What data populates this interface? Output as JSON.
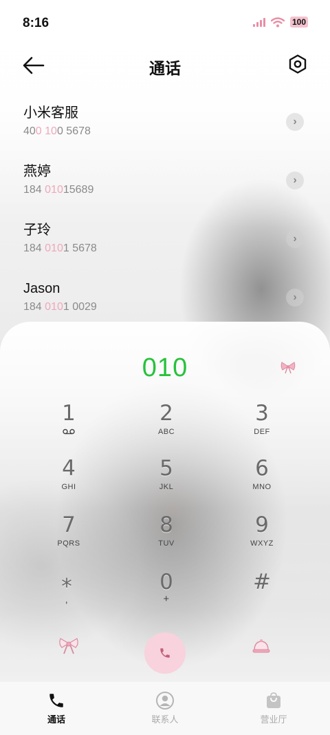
{
  "status_bar": {
    "time": "8:16",
    "battery": "100",
    "signal_color": "#e88ea5"
  },
  "header": {
    "title": "通话",
    "back_icon": "back-arrow-icon",
    "settings_icon": "settings-icon"
  },
  "contacts": [
    {
      "name": "小米客服",
      "num_a": "40",
      "num_b": "0",
      "num_c": " ",
      "num_d": "10",
      "num_e": "0 5678"
    },
    {
      "name": "燕婷",
      "num_a": "184 ",
      "num_b": "",
      "num_c": "",
      "num_d": "010",
      "num_e": "15689"
    },
    {
      "name": "子玲",
      "num_a": "184 ",
      "num_b": "",
      "num_c": "",
      "num_d": "010",
      "num_e": "1 5678"
    },
    {
      "name": "Jason",
      "num_a": "184 ",
      "num_b": "",
      "num_c": "",
      "num_d": "010",
      "num_e": "1 0029"
    }
  ],
  "dialed_number": "010",
  "keypad": [
    {
      "digit": "1",
      "letters": "ꝏ"
    },
    {
      "digit": "2",
      "letters": "ABC"
    },
    {
      "digit": "3",
      "letters": "DEF"
    },
    {
      "digit": "4",
      "letters": "GHI"
    },
    {
      "digit": "5",
      "letters": "JKL"
    },
    {
      "digit": "6",
      "letters": "MNO"
    },
    {
      "digit": "7",
      "letters": "PQRS"
    },
    {
      "digit": "8",
      "letters": "TUV"
    },
    {
      "digit": "9",
      "letters": "WXYZ"
    },
    {
      "digit": "*",
      "letters": ","
    },
    {
      "digit": "0",
      "letters": "+"
    },
    {
      "digit": "#",
      "letters": ""
    }
  ],
  "tabs": [
    {
      "label": "通话",
      "icon": "phone-icon",
      "active": true
    },
    {
      "label": "联系人",
      "icon": "person-icon",
      "active": false
    },
    {
      "label": "营业厅",
      "icon": "shopping-bag-icon",
      "active": false
    }
  ],
  "colors": {
    "accent_green": "#27c23c",
    "highlight_pink": "#f0a7ba",
    "call_button": "#f8d2dc"
  }
}
